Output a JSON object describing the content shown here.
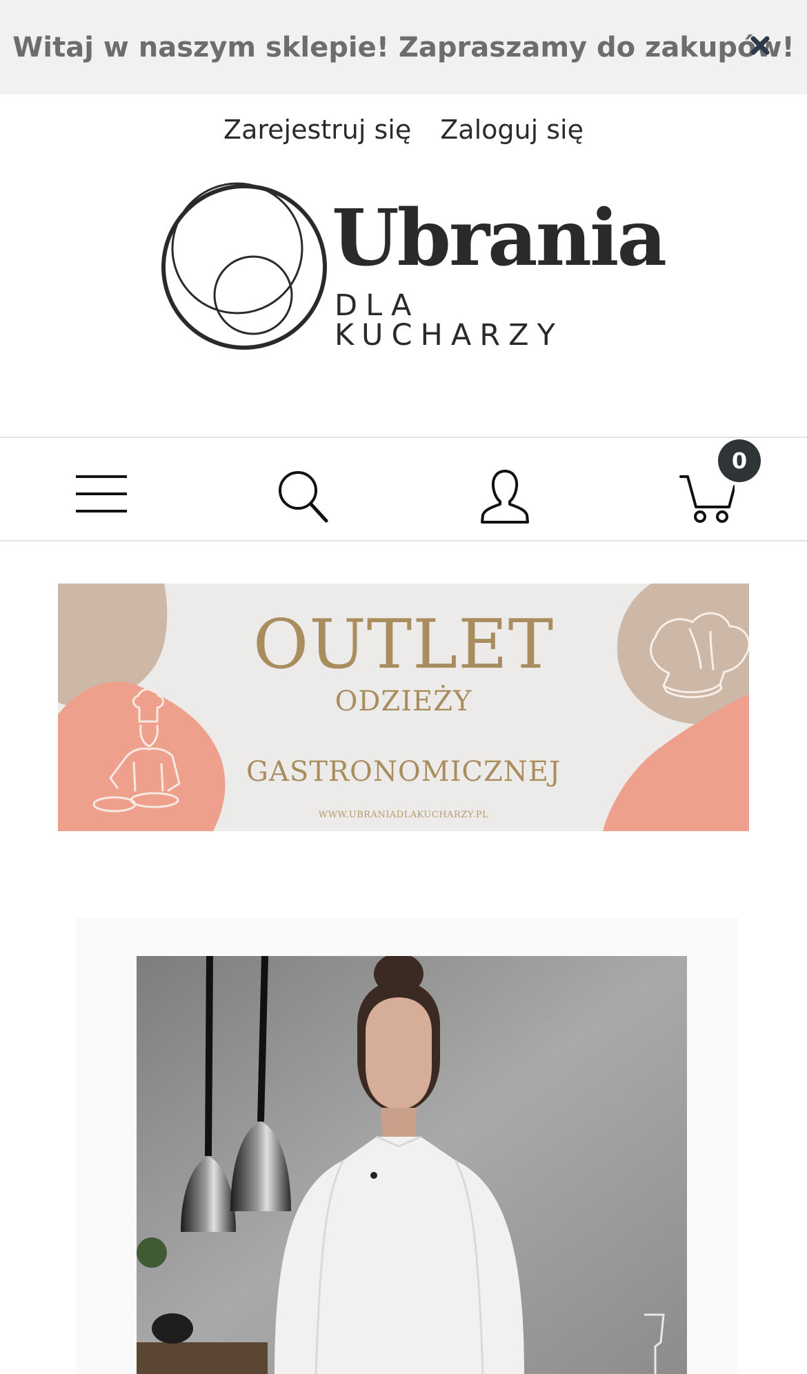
{
  "topbar": {
    "message": "Witaj w naszym sklepie! Zapraszamy do zakupów!",
    "close_icon": "close-icon"
  },
  "account": {
    "register_label": "Zarejestruj się",
    "login_label": "Zaloguj się"
  },
  "logo": {
    "main": "Ubrania",
    "sub": "DLA KUCHARZY"
  },
  "nav": {
    "menu_icon": "hamburger-icon",
    "search_icon": "search-icon",
    "user_icon": "user-icon",
    "cart_icon": "cart-icon",
    "cart_count": "0"
  },
  "banner": {
    "title": "OUTLET",
    "line1": "ODZIEŻY",
    "line2": "GASTRONOMICZNEJ",
    "url": "WWW.UBRANIADLAKUCHARZY.PL",
    "colors": {
      "beige": "#cdb7a6",
      "coral": "#eea08c",
      "gold": "#a98d5e",
      "background": "#ecebea"
    }
  },
  "product": {
    "image_icon": "product-photo-chef-jacket"
  }
}
